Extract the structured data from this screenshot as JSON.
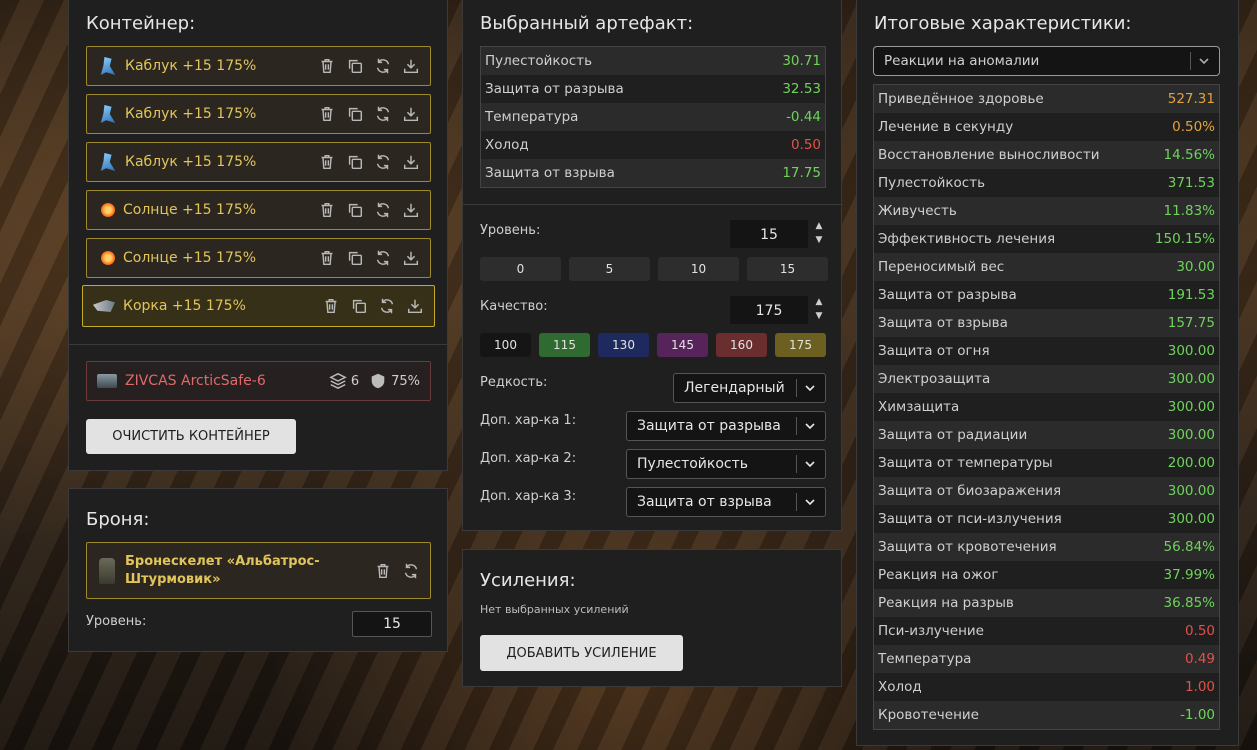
{
  "container": {
    "title": "Контейнер:",
    "artifacts": [
      {
        "name": "Каблук +15 175%",
        "icon": "kabluk-icon"
      },
      {
        "name": "Каблук +15 175%",
        "icon": "kabluk-icon"
      },
      {
        "name": "Каблук +15 175%",
        "icon": "kabluk-icon"
      },
      {
        "name": "Солнце +15 175%",
        "icon": "sun-icon"
      },
      {
        "name": "Солнце +15 175%",
        "icon": "sun-icon"
      },
      {
        "name": "Корка +15 175%",
        "icon": "korka-icon"
      }
    ],
    "case": {
      "name": "ZIVCAS ArcticSafe-6",
      "slots": "6",
      "protection": "75%"
    },
    "clear_button": "ОЧИСТИТЬ КОНТЕЙНЕР"
  },
  "armor": {
    "title": "Броня:",
    "name": "Бронескелет «Альбатрос-Штурмовик»",
    "level_label": "Уровень:",
    "level_value": "15"
  },
  "artifact": {
    "title": "Выбранный артефакт:",
    "stats": [
      {
        "label": "Пулестойкость",
        "value": "30.71",
        "color": "green"
      },
      {
        "label": "Защита от разрыва",
        "value": "32.53",
        "color": "green"
      },
      {
        "label": "Температура",
        "value": "-0.44",
        "color": "green"
      },
      {
        "label": "Холод",
        "value": "0.50",
        "color": "red"
      },
      {
        "label": "Защита от взрыва",
        "value": "17.75",
        "color": "green"
      }
    ],
    "level_label": "Уровень:",
    "level_value": "15",
    "level_presets": [
      "0",
      "5",
      "10",
      "15"
    ],
    "quality_label": "Качество:",
    "quality_value": "175",
    "quality_presets": [
      {
        "label": "100",
        "color": "#151515"
      },
      {
        "label": "115",
        "color": "#2f6a31"
      },
      {
        "label": "130",
        "color": "#1e2a5e"
      },
      {
        "label": "145",
        "color": "#56245a"
      },
      {
        "label": "160",
        "color": "#6a2e2e"
      },
      {
        "label": "175",
        "color": "#6c6020"
      }
    ],
    "rarity_label": "Редкость:",
    "rarity_value": "Легендарный",
    "extra1_label": "Доп. хар-ка 1:",
    "extra1_value": "Защита от разрыва",
    "extra2_label": "Доп. хар-ка 2:",
    "extra2_value": "Пулестойкость",
    "extra3_label": "Доп. хар-ка 3:",
    "extra3_value": "Защита от взрыва"
  },
  "boosts": {
    "title": "Усиления:",
    "empty_text": "Нет выбранных усилений",
    "add_button": "ДОБАВИТЬ УСИЛЕНИЕ"
  },
  "totals": {
    "title": "Итоговые характеристики:",
    "filter_value": "Реакции на аномалии",
    "stats": [
      {
        "label": "Приведённое здоровье",
        "value": "527.31",
        "color": "orange"
      },
      {
        "label": "Лечение в секунду",
        "value": "0.50%",
        "color": "orange"
      },
      {
        "label": "Восстановление выносливости",
        "value": "14.56%",
        "color": "green"
      },
      {
        "label": "Пулестойкость",
        "value": "371.53",
        "color": "green"
      },
      {
        "label": "Живучесть",
        "value": "11.83%",
        "color": "green"
      },
      {
        "label": "Эффективность лечения",
        "value": "150.15%",
        "color": "green"
      },
      {
        "label": "Переносимый вес",
        "value": "30.00",
        "color": "green"
      },
      {
        "label": "Защита от разрыва",
        "value": "191.53",
        "color": "green"
      },
      {
        "label": "Защита от взрыва",
        "value": "157.75",
        "color": "green"
      },
      {
        "label": "Защита от огня",
        "value": "300.00",
        "color": "green"
      },
      {
        "label": "Электрозащита",
        "value": "300.00",
        "color": "green"
      },
      {
        "label": "Химзащита",
        "value": "300.00",
        "color": "green"
      },
      {
        "label": "Защита от радиации",
        "value": "300.00",
        "color": "green"
      },
      {
        "label": "Защита от температуры",
        "value": "200.00",
        "color": "green"
      },
      {
        "label": "Защита от биозаражения",
        "value": "300.00",
        "color": "green"
      },
      {
        "label": "Защита от пси-излучения",
        "value": "300.00",
        "color": "green"
      },
      {
        "label": "Защита от кровотечения",
        "value": "56.84%",
        "color": "green"
      },
      {
        "label": "Реакция на ожог",
        "value": "37.99%",
        "color": "green"
      },
      {
        "label": "Реакция на разрыв",
        "value": "36.85%",
        "color": "green"
      },
      {
        "label": "Пси-излучение",
        "value": "0.50",
        "color": "red"
      },
      {
        "label": "Температура",
        "value": "0.49",
        "color": "red"
      },
      {
        "label": "Холод",
        "value": "1.00",
        "color": "red"
      },
      {
        "label": "Кровотечение",
        "value": "-1.00",
        "color": "green"
      }
    ]
  }
}
